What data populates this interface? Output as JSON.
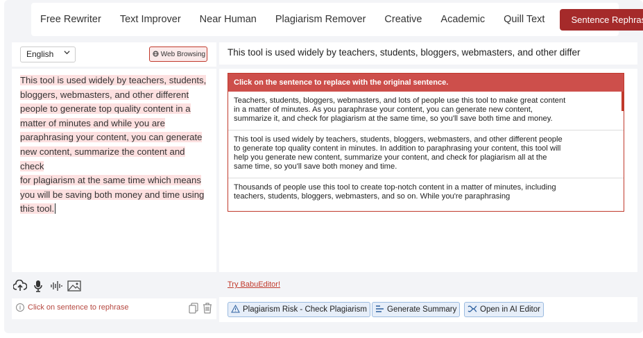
{
  "modes": [
    "Free Rewriter",
    "Text Improver",
    "Near Human",
    "Plagiarism Remover",
    "Creative",
    "Academic",
    "Quill Text"
  ],
  "active_mode": "Sentence Rephraser",
  "left": {
    "language": "English",
    "web_browsing_label": "Web Browsing",
    "input_text": "This tool is used widely by teachers, students, bloggers, webmasters, and other different people to generate top quality content in a matter of minutes and while you are paraphrasing your content, you can generate new content, summarize the content and check for plagiarism at the same time which means you will be saving both money and time using this tool.",
    "input_lines": [
      "This tool is used widely by teachers, students,",
      "bloggers, webmasters, and other different",
      "people to generate top quality content in a",
      "matter of minutes and while you are",
      "paraphrasing your content, you can generate",
      "new content, summarize the content and check",
      "for plagiarism at the same time which means",
      "you will be saving both money and time using",
      "this tool."
    ],
    "hint": "Click on sentence to rephrase"
  },
  "right": {
    "original_sentence": "This tool is used widely by teachers, students, bloggers, webmasters, and other differ",
    "results_header": "Click on the sentence to replace with the original sentence.",
    "results": [
      "Teachers, students, bloggers, webmasters, and lots of people use this tool to make great content in a matter of minutes. As you paraphrase your content, you can generate new content, summarize it, and check for plagiarism at the same time, so you'll save both time and money.",
      "This tool is used widely by teachers, students, bloggers, webmasters, and other different people to generate top quality content in minutes. In addition to paraphrasing your content, this tool will help you generate new content, summarize your content, and check for plagiarism all at the same time, so you'll save both money and time.",
      "Thousands of people use this tool to create top-notch content in a matter of minutes, including teachers, students, bloggers, webmasters, and so on. While you're paraphrasing"
    ],
    "try_link": "Try BabuEditor!",
    "actions": {
      "plagiarism": "Plagiarism Risk - Check Plagiarism",
      "summary": "Generate Summary",
      "ai_editor": "Open in AI Editor"
    }
  },
  "icons": {
    "upload": "cloud-upload-icon",
    "mic": "microphone-icon",
    "waveform": "audio-wave-icon",
    "image": "image-icon",
    "info": "info-icon",
    "copy": "copy-icon",
    "trash": "trash-icon",
    "globe": "globe-icon"
  },
  "colors": {
    "accent": "#a52a2a",
    "highlight": "#fde0e0",
    "header": "#cd4f4b",
    "action": "#e6eef9"
  }
}
